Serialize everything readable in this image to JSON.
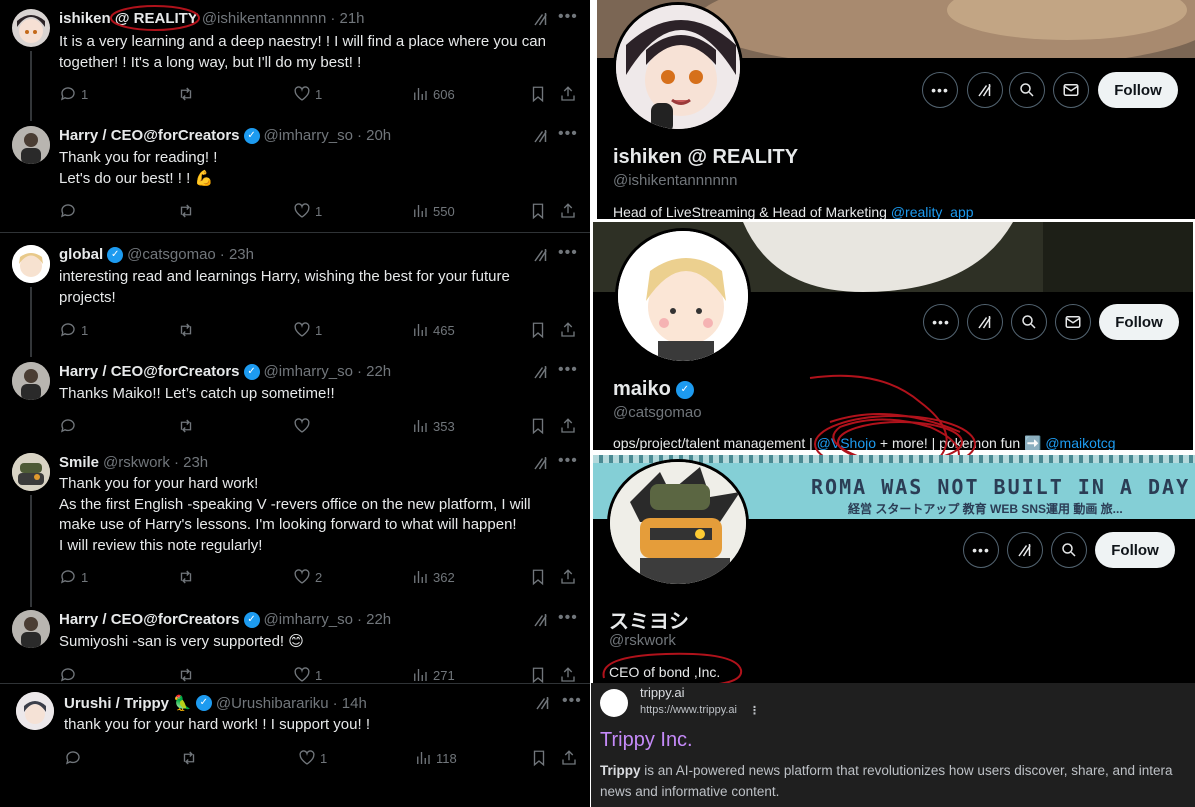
{
  "tweets": [
    {
      "name": "ishiken @ REALITY",
      "verified": false,
      "handle": "@ishikentannnnnn",
      "time": "· 21h",
      "lines": [
        "It is a very learning and a deep naestry! ! I will find a place where you can",
        "together! ! It's a long way, but I'll do my best! !"
      ],
      "replies": "1",
      "reposts": "",
      "likes": "1",
      "views": "606"
    },
    {
      "name": "Harry / CEO@forCreators",
      "verified": true,
      "handle": "@imharry_so",
      "time": "· 20h",
      "lines": [
        "Thank you for reading! !",
        "Let's do our best! ! ! 💪"
      ],
      "replies": "",
      "reposts": "",
      "likes": "1",
      "views": "550"
    },
    {
      "name": "global",
      "verified": true,
      "handle": "@catsgomao",
      "time": "· 23h",
      "lines": [
        "interesting read and learnings Harry, wishing the best for your future",
        "projects!"
      ],
      "replies": "1",
      "reposts": "",
      "likes": "1",
      "views": "465"
    },
    {
      "name": "Harry / CEO@forCreators",
      "verified": true,
      "handle": "@imharry_so",
      "time": "· 22h",
      "lines": [
        "Thanks Maiko!! Let’s catch up sometime!!"
      ],
      "replies": "",
      "reposts": "",
      "likes": "",
      "views": "353"
    },
    {
      "name": "Smile",
      "verified": false,
      "handle": "@rskwork",
      "time": "· 23h",
      "lines": [
        "Thank you for your hard work!",
        "As the first English -speaking V -revers office on the new platform, I will",
        "make use of Harry's lessons. I'm looking forward to what will happen!",
        "I will review this note regularly!"
      ],
      "replies": "1",
      "reposts": "",
      "likes": "2",
      "views": "362"
    },
    {
      "name": "Harry / CEO@forCreators",
      "verified": true,
      "handle": "@imharry_so",
      "time": "· 22h",
      "lines": [
        "Sumiyoshi -san is very supported! 😊"
      ],
      "replies": "",
      "reposts": "",
      "likes": "1",
      "views": "271"
    },
    {
      "name": "Urushi / Trippy 🦜",
      "verified": true,
      "handle": "@Urushibarariku",
      "time": "· 14h",
      "lines": [
        "thank you for your hard work! ! I support you! !"
      ],
      "replies": "",
      "reposts": "",
      "likes": "1",
      "views": "118"
    }
  ],
  "profiles": [
    {
      "name": "ishiken @ REALITY",
      "handle": "@ishikentannnnnn",
      "bio": "Head of LiveStreaming & Head of Marketing",
      "bio_link": "@reality_app",
      "follow": "Follow"
    },
    {
      "name": "maiko",
      "handle": "@catsgomao",
      "bio_a": "ops/project/talent management |",
      "bio_link1": "@VShojo",
      "bio_b": "+ more! | pokemon fun ➡️",
      "bio_link2": "@maikotcg",
      "follow": "Follow"
    },
    {
      "name": "スミヨシ",
      "handle": "@rskwork",
      "bio": "CEO of bond ,Inc.",
      "banner": "ROMA WAS NOT BUILT IN A DAY",
      "banner_sub": "経営 スタートアップ 教育 WEB SNS運用 動画 旅...",
      "follow": "Follow"
    }
  ],
  "search_result": {
    "site": "trippy.ai",
    "url": "https://www.trippy.ai",
    "title": "Trippy Inc.",
    "snippet_bold": "Trippy",
    "snippet_1": " is an AI-powered news platform that revolutionizes how users discover, share, and intera",
    "snippet_2": "news and informative content."
  },
  "colors": {
    "bg": "#000000",
    "text": "#e7e9ea",
    "muted": "#71767b",
    "link": "#1d9bf0",
    "annotation": "#b0121b",
    "result_title": "#c58af9"
  }
}
